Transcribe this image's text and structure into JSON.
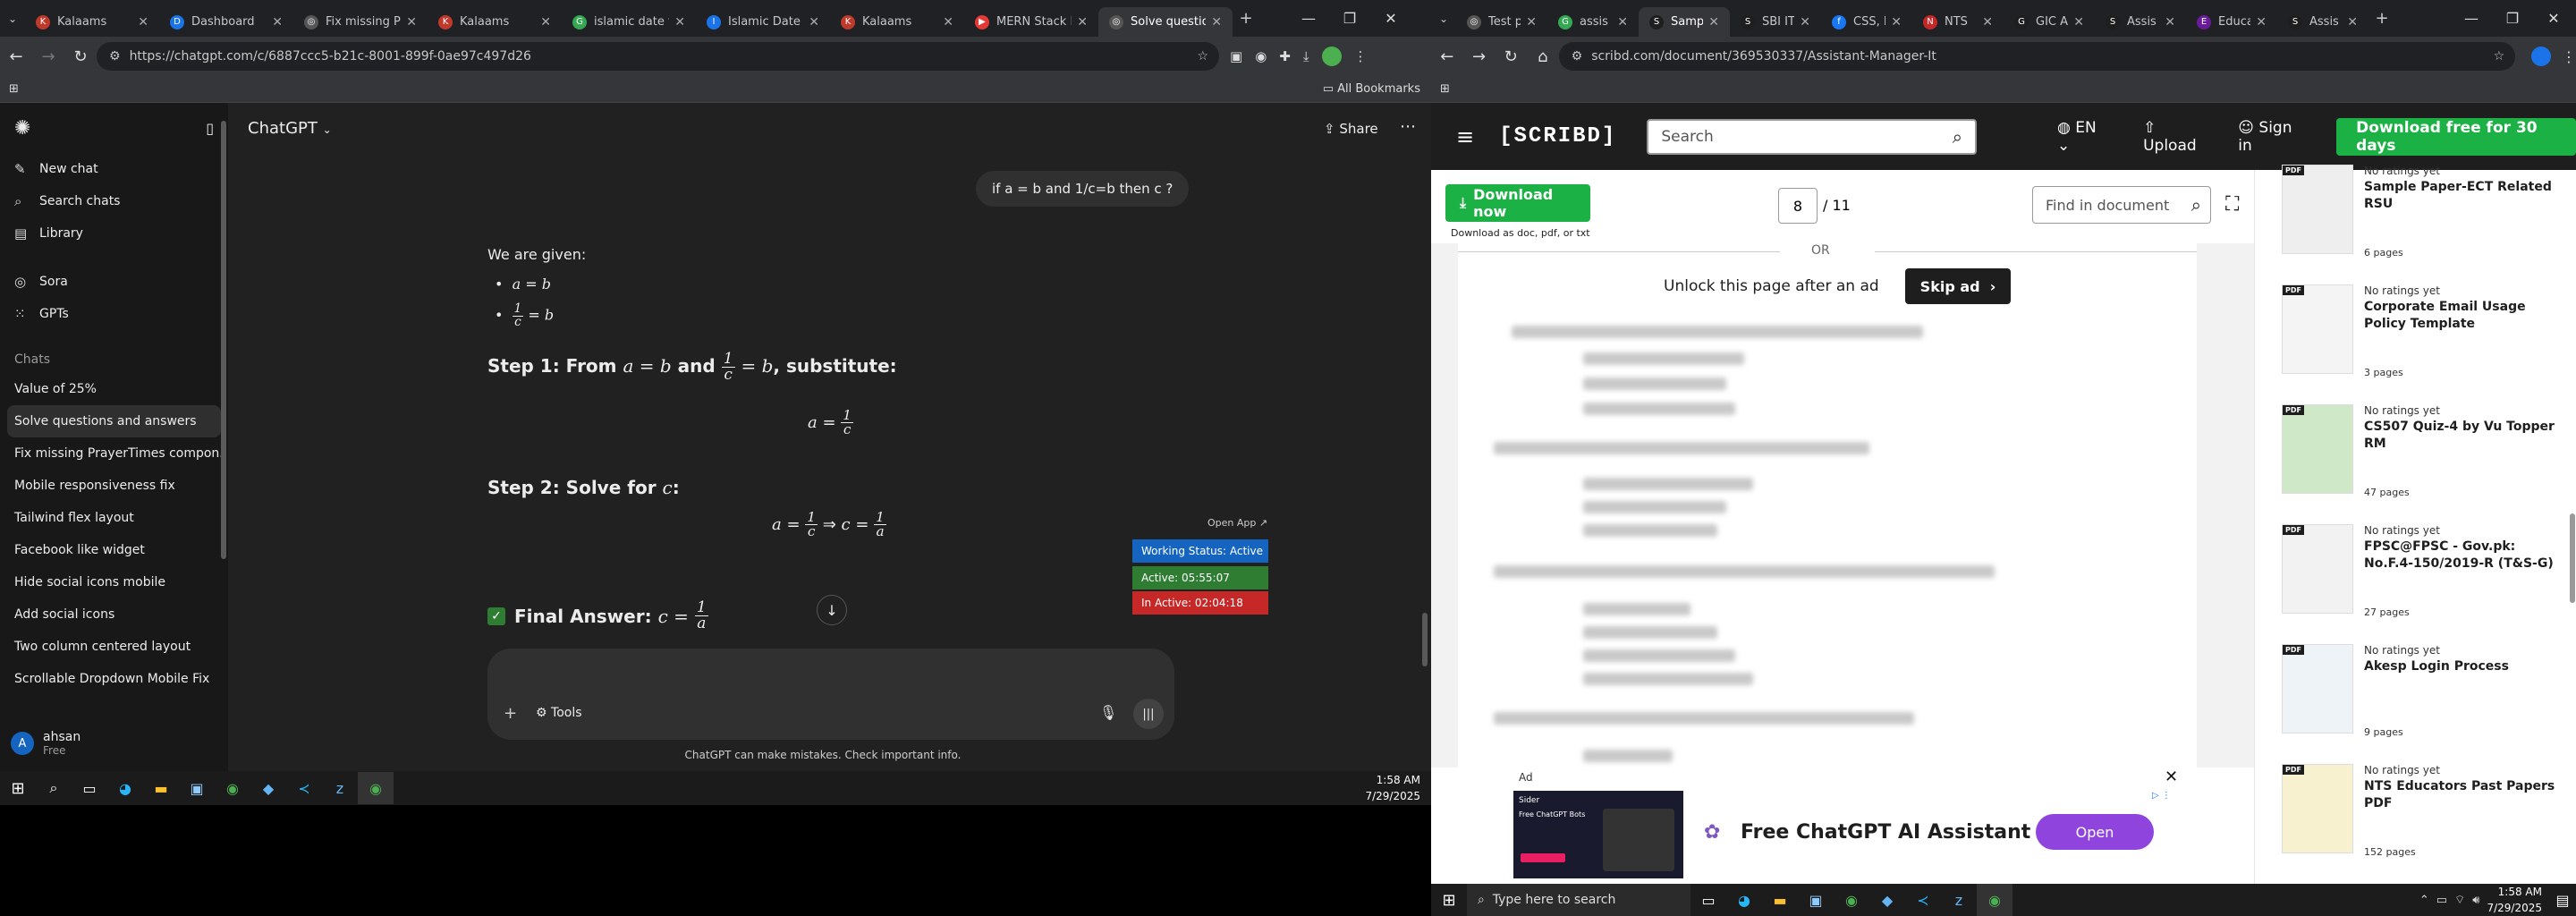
{
  "left": {
    "tabs": [
      {
        "title": "Kalaams",
        "color": "#c0392b",
        "icon": "K"
      },
      {
        "title": "Dashboard",
        "color": "#1a73e8",
        "icon": "D"
      },
      {
        "title": "Fix missing Pra",
        "color": "#555555",
        "icon": "◎"
      },
      {
        "title": "Kalaams",
        "color": "#c0392b",
        "icon": "K"
      },
      {
        "title": "islamic date fo",
        "color": "#34a853",
        "icon": "G"
      },
      {
        "title": "Islamic Date To",
        "color": "#1a73e8",
        "icon": "I"
      },
      {
        "title": "Kalaams",
        "color": "#c0392b",
        "icon": "K"
      },
      {
        "title": "MERN Stack Fu",
        "color": "#e53935",
        "icon": "▶"
      },
      {
        "title": "Solve question",
        "color": "#555555",
        "icon": "◎"
      }
    ],
    "url": "https://chatgpt.com/c/6887ccc5-b21c-8001-899f-0ae97c497d26",
    "all_bookmarks": "All Bookmarks",
    "sidebar": {
      "new_chat": "New chat",
      "search_chats": "Search chats",
      "library": "Library",
      "sora": "Sora",
      "gpts": "GPTs",
      "chats_label": "Chats",
      "chats": [
        "Value of 25%",
        "Solve questions and answers",
        "Fix missing PrayerTimes compon...",
        "Mobile responsiveness fix",
        "Tailwind flex layout",
        "Facebook like widget",
        "Hide social icons mobile",
        "Add social icons",
        "Two column centered layout",
        "Scrollable Dropdown Mobile Fix"
      ],
      "user_name": "ahsan",
      "user_initial": "A",
      "user_plan": "Free"
    },
    "header": {
      "model": "ChatGPT",
      "share": "Share"
    },
    "user_message": "if a = b and 1/c=b then c ?",
    "answer": {
      "given": "We are given:",
      "step1": "Step 1: From",
      "step1_and": "and",
      "step1_sub": ", substitute:",
      "step2": "Step 2: Solve for",
      "final": "Final Answer:"
    },
    "overlay": {
      "open_app": "Open App ↗",
      "working": "Working Status: Active",
      "active": "Active: 05:55:07",
      "inactive": "In Active: 02:04:18"
    },
    "composer": {
      "tools": "Tools"
    },
    "disclaimer": "ChatGPT can make mistakes. Check important info.",
    "clock": {
      "time": "1:58 AM",
      "date": "7/29/2025"
    }
  },
  "right": {
    "tabs": [
      {
        "title": "Test p",
        "color": "#555555",
        "icon": "◎"
      },
      {
        "title": "assis",
        "color": "#34a853",
        "icon": "G"
      },
      {
        "title": "Samp",
        "color": "#1e1e1e",
        "icon": "S"
      },
      {
        "title": "SBI IT",
        "color": "#1e1e1e",
        "icon": "S"
      },
      {
        "title": "CSS, I",
        "color": "#1877f2",
        "icon": "f"
      },
      {
        "title": "NTS",
        "color": "#c62828",
        "icon": "N"
      },
      {
        "title": "GIC A",
        "color": "#1e1e1e",
        "icon": "G"
      },
      {
        "title": "Assis",
        "color": "#1e1e1e",
        "icon": "S"
      },
      {
        "title": "Educa",
        "color": "#6a1b9a",
        "icon": "E"
      },
      {
        "title": "Assis",
        "color": "#1e1e1e",
        "icon": "S"
      }
    ],
    "url": "scribd.com/document/369530337/Assistant-Manager-It",
    "header": {
      "logo": "[SCRIBD]",
      "search_placeholder": "Search",
      "lang": "EN",
      "upload": "Upload",
      "signin": "Sign in",
      "cta": "Download free for 30 days"
    },
    "toolbar": {
      "download": "Download now",
      "download_sub": "Download as doc, pdf, or txt",
      "page_current": "8",
      "page_total": "/ 11",
      "find_placeholder": "Find in document"
    },
    "doc": {
      "or": "OR",
      "unlock": "Unlock this page after an ad",
      "skip": "Skip ad"
    },
    "ad": {
      "label": "Ad",
      "title": "Free ChatGPT AI Assistant",
      "open": "Open",
      "thumb_title": "Sider",
      "thumb_sub": "Free ChatGPT Bots"
    },
    "related": [
      {
        "rating": "No ratings yet",
        "title": "Sample Paper-ECT Related RSU",
        "pages": "6 pages",
        "pdf": "PDF"
      },
      {
        "rating": "No ratings yet",
        "title": "Corporate Email Usage Policy Template",
        "pages": "3 pages",
        "pdf": "PDF"
      },
      {
        "rating": "No ratings yet",
        "title": "CS507 Quiz-4 by Vu Topper RM",
        "pages": "47 pages",
        "pdf": "PDF"
      },
      {
        "rating": "No ratings yet",
        "title": "FPSC@FPSC - Gov.pk: No.F.4-150/2019-R (T&S-G)",
        "pages": "27 pages",
        "pdf": "PDF"
      },
      {
        "rating": "No ratings yet",
        "title": "Akesp Login Process",
        "pages": "9 pages",
        "pdf": "PDF"
      },
      {
        "rating": "No ratings yet",
        "title": "NTS Educators Past Papers PDF",
        "pages": "152 pages",
        "pdf": "PDF"
      }
    ],
    "taskbar": {
      "search": "Type here to search",
      "time": "1:58 AM",
      "date": "7/29/2025"
    }
  }
}
